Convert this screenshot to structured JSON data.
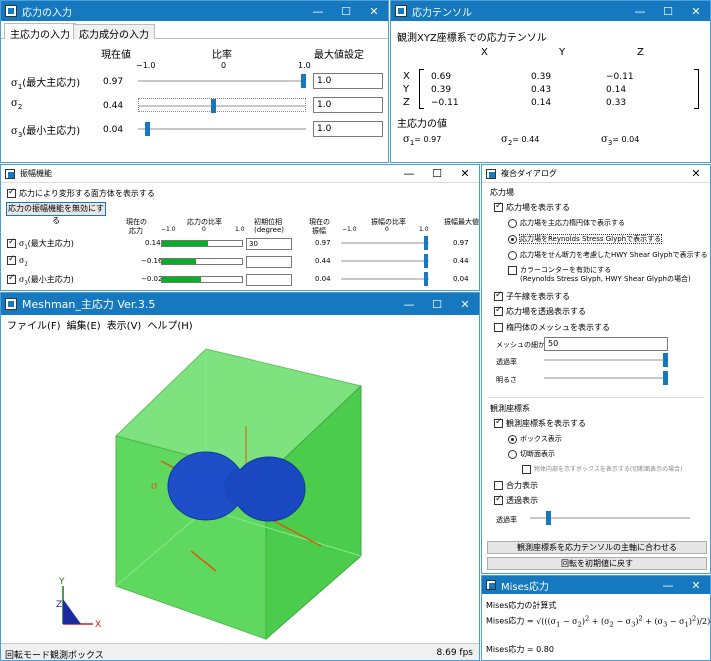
{
  "stress_input": {
    "title": "応力の入力",
    "tabs": [
      "主応力の入力",
      "応力成分の入力"
    ],
    "col_current": "現在値",
    "col_ratio": "比率",
    "col_max": "最大値設定",
    "scale": [
      "−1.0",
      "0",
      "1.0"
    ],
    "rows": [
      {
        "label": "σ1(最大主応力)",
        "sym": "σ",
        "sub": "1",
        "suffix": "(最大主応力)",
        "value": "0.97",
        "ratio": 1.0,
        "max": "1.0"
      },
      {
        "label": "σ2",
        "sym": "σ",
        "sub": "2",
        "suffix": "",
        "value": "0.44",
        "ratio": 0.44,
        "max": "1.0"
      },
      {
        "label": "σ3(最小主応力)",
        "sym": "σ",
        "sub": "3",
        "suffix": "(最小主応力)",
        "value": "0.04",
        "ratio": 0.04,
        "max": "1.0"
      }
    ]
  },
  "tensor": {
    "title": "応力テンソル",
    "heading": "観測XYZ座標系での応力テンソル",
    "cols": [
      "X",
      "Y",
      "Z"
    ],
    "rows": [
      "X",
      "Y",
      "Z"
    ],
    "matrix": [
      [
        "0.69",
        "0.39",
        "−0.11"
      ],
      [
        "0.39",
        "0.43",
        "0.14"
      ],
      [
        "−0.11",
        "0.14",
        "0.33"
      ]
    ],
    "principal_heading": "主応力の値",
    "principal": [
      {
        "sym": "σ",
        "sub": "1",
        "value": "= 0.97"
      },
      {
        "sym": "σ",
        "sub": "2",
        "value": "= 0.44"
      },
      {
        "sym": "σ",
        "sub": "3",
        "value": "= 0.04"
      }
    ]
  },
  "vibration": {
    "title": "振幅機能",
    "opt1": "応力により変形する面方体を表示する",
    "button": "応力の振幅機能を無効にする",
    "h_current": [
      "現在の",
      "応力"
    ],
    "h_ratio": "応力の比率",
    "h_phase": [
      "初期位相",
      "(degree)"
    ],
    "h_amp": [
      "現在の",
      "振幅"
    ],
    "h_amp_ratio": "振幅の比率",
    "h_amp_max": "振幅最大値",
    "scale": [
      "−1.0",
      "0",
      "1.0"
    ],
    "rows": [
      {
        "sym": "σ",
        "sub": "1",
        "suffix": "(最大主応力)",
        "current": "0.14",
        "ratio": 0.57,
        "phase": "30",
        "amp": "0.97",
        "amp_ratio": 1.0,
        "amp_max": "0.97"
      },
      {
        "sym": "σ",
        "sub": "2",
        "suffix": "",
        "current": "−0.16",
        "ratio": 0.42,
        "phase": "",
        "amp": "0.44",
        "amp_ratio": 1.0,
        "amp_max": "0.44"
      },
      {
        "sym": "σ",
        "sub": "3",
        "suffix": "(最小主応力)",
        "current": "−0.02",
        "ratio": 0.49,
        "phase": "",
        "amp": "0.04",
        "amp_ratio": 1.0,
        "amp_max": "0.04"
      }
    ]
  },
  "viewer": {
    "title": "Meshman_主応力 Ver.3.5",
    "menu": [
      "ファイル(F)",
      "編集(E)",
      "表示(V)",
      "ヘルプ(H)"
    ],
    "axis_y": "Y",
    "axis_z": "Z",
    "axis_x": "X",
    "sigma_label": "σ",
    "status_left": "回転モード観測ボックス",
    "status_right": "8.69 fps"
  },
  "options": {
    "title": "複合ダイアログ",
    "group1": "応力場",
    "show_field": "応力場を表示する",
    "r1": "応力場を主応力楕円体で表示する",
    "r2": "応力場をReynolds Stress Glyphで表示する",
    "r3": "応力場をせん断力を考慮したHWY Shear Glyphで表示する",
    "color_contour": "カラーコンターを有効にする",
    "color_contour2": "(Reynolds Stress Glyph, HWY Shear Glyphの場合)",
    "cross": "子午線を表示する",
    "transparent": "応力場を透過表示する",
    "ellipse_mesh": "楕円体のメッシュを表示する",
    "mesh_label": "メッシュの細かさ",
    "mesh_value": "50",
    "transp_label": "透過率",
    "transp_level": 1.0,
    "bright_label": "明るさ",
    "bright_level": 1.0,
    "group2": "観測座標系",
    "show_coord": "観測座標系を表示する",
    "box": "ボックス表示",
    "section": "切断面表示",
    "inside": "物体内部を示すボックスを表示する(切断面表示の場合)",
    "resultant": "合力表示",
    "transparent2": "透過表示",
    "transp2_label": "透過率",
    "transp2_level": 0.1,
    "btn1": "観測座標系を応力テンソルの主軸に合わせる",
    "btn2": "回転を初期値に戻す"
  },
  "mises": {
    "title": "Mises応力",
    "heading": "Mises応力の計算式",
    "formula_left": "Mises応力 =",
    "result": "Mises応力 = 0.80"
  }
}
